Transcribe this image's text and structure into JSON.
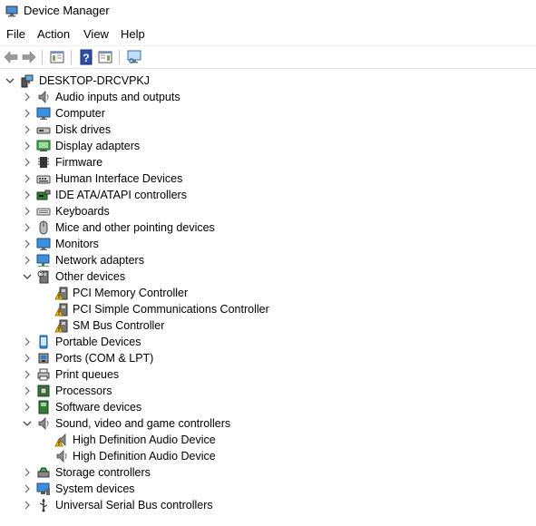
{
  "window": {
    "title": "Device Manager"
  },
  "menu": [
    "File",
    "Action",
    "View",
    "Help"
  ],
  "toolbar": [
    {
      "name": "back-button",
      "icon": "back-arrow-icon"
    },
    {
      "name": "forward-button",
      "icon": "forward-arrow-icon"
    },
    {
      "name": "show-hide-console-tree-button",
      "icon": "console-tree-icon"
    },
    {
      "name": "help-button",
      "icon": "help-icon"
    },
    {
      "name": "properties-button",
      "icon": "properties-icon"
    },
    {
      "name": "scan-hardware-changes-button",
      "icon": "monitor-scan-icon"
    }
  ],
  "tree": [
    {
      "label": "DESKTOP-DRCVPKJ",
      "level": 0,
      "expand": "expanded",
      "icon": "computer-tower"
    },
    {
      "label": "Audio inputs and outputs",
      "level": 1,
      "expand": "collapsed",
      "icon": "speaker"
    },
    {
      "label": "Computer",
      "level": 1,
      "expand": "collapsed",
      "icon": "monitor"
    },
    {
      "label": "Disk drives",
      "level": 1,
      "expand": "collapsed",
      "icon": "disk"
    },
    {
      "label": "Display adapters",
      "level": 1,
      "expand": "collapsed",
      "icon": "display-adapter"
    },
    {
      "label": "Firmware",
      "level": 1,
      "expand": "collapsed",
      "icon": "chip"
    },
    {
      "label": "Human Interface Devices",
      "level": 1,
      "expand": "collapsed",
      "icon": "hid"
    },
    {
      "label": "IDE ATA/ATAPI controllers",
      "level": 1,
      "expand": "collapsed",
      "icon": "ide"
    },
    {
      "label": "Keyboards",
      "level": 1,
      "expand": "collapsed",
      "icon": "keyboard"
    },
    {
      "label": "Mice and other pointing devices",
      "level": 1,
      "expand": "collapsed",
      "icon": "mouse"
    },
    {
      "label": "Monitors",
      "level": 1,
      "expand": "collapsed",
      "icon": "monitor"
    },
    {
      "label": "Network adapters",
      "level": 1,
      "expand": "collapsed",
      "icon": "network"
    },
    {
      "label": "Other devices",
      "level": 1,
      "expand": "expanded",
      "icon": "other-device"
    },
    {
      "label": "PCI Memory Controller",
      "level": 2,
      "expand": "none",
      "icon": "warning-device"
    },
    {
      "label": "PCI Simple Communications Controller",
      "level": 2,
      "expand": "none",
      "icon": "warning-device"
    },
    {
      "label": "SM Bus Controller",
      "level": 2,
      "expand": "none",
      "icon": "warning-device"
    },
    {
      "label": "Portable Devices",
      "level": 1,
      "expand": "collapsed",
      "icon": "portable"
    },
    {
      "label": "Ports (COM & LPT)",
      "level": 1,
      "expand": "collapsed",
      "icon": "port"
    },
    {
      "label": "Print queues",
      "level": 1,
      "expand": "collapsed",
      "icon": "printer"
    },
    {
      "label": "Processors",
      "level": 1,
      "expand": "collapsed",
      "icon": "processor"
    },
    {
      "label": "Software devices",
      "level": 1,
      "expand": "collapsed",
      "icon": "software"
    },
    {
      "label": "Sound, video and game controllers",
      "level": 1,
      "expand": "expanded",
      "icon": "speaker"
    },
    {
      "label": "High Definition Audio Device",
      "level": 2,
      "expand": "none",
      "icon": "warning-speaker"
    },
    {
      "label": "High Definition Audio Device",
      "level": 2,
      "expand": "none",
      "icon": "speaker"
    },
    {
      "label": "Storage controllers",
      "level": 1,
      "expand": "collapsed",
      "icon": "storage"
    },
    {
      "label": "System devices",
      "level": 1,
      "expand": "collapsed",
      "icon": "system"
    },
    {
      "label": "Universal Serial Bus controllers",
      "level": 1,
      "expand": "collapsed",
      "icon": "usb"
    }
  ],
  "colors": {
    "warning": "#f5c400",
    "accent": "#2b7cd3",
    "chevron": "#555555"
  }
}
